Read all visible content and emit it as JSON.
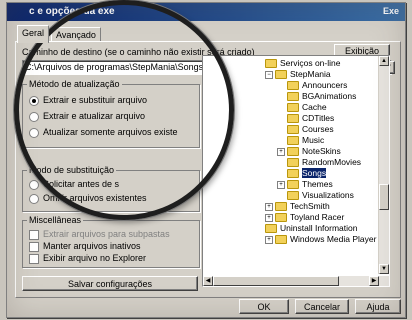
{
  "window": {
    "title": "c e opções da exe",
    "title_right": "Exe"
  },
  "tabs": [
    {
      "label": "Geral",
      "active": true
    },
    {
      "label": "Avançado",
      "active": false
    }
  ],
  "destination": {
    "label": "Caminho de destino (se o caminho não existir será criado)",
    "value": "C:\\Arquivos de programas\\StepMania\\Songs",
    "browse_label": "Exibição"
  },
  "update_method": {
    "title": "Método de atualização",
    "options": [
      {
        "label": "Extrair e substituir arquivo",
        "selected": true
      },
      {
        "label": "Extrair e atualizar arquivo",
        "selected": false
      },
      {
        "label": "Atualizar somente arquivos existe",
        "selected": false
      }
    ]
  },
  "replace_mode": {
    "title": "Modo de substituição",
    "options": [
      {
        "label": "Solicitar antes de s",
        "selected": false
      },
      {
        "label": "Omitir arquivos existentes",
        "selected": false
      }
    ]
  },
  "misc": {
    "title": "Miscellâneas",
    "checks": [
      {
        "label": "Extrair arquivos para subpastas",
        "checked": false,
        "disabled": true
      },
      {
        "label": "Manter arquivos inativos",
        "checked": false,
        "disabled": false
      },
      {
        "label": "Exibir arquivo no Explorer",
        "checked": false,
        "disabled": false
      }
    ]
  },
  "save_config_label": "Salvar configurações",
  "folder_tree": [
    {
      "label": "Serviços on-line",
      "level": 0,
      "expander": "",
      "selected": false
    },
    {
      "label": "StepMania",
      "level": 0,
      "expander": "-",
      "selected": false
    },
    {
      "label": "Announcers",
      "level": 1,
      "expander": "",
      "selected": false
    },
    {
      "label": "BGAnimations",
      "level": 1,
      "expander": "",
      "selected": false
    },
    {
      "label": "Cache",
      "level": 1,
      "expander": "",
      "selected": false
    },
    {
      "label": "CDTitles",
      "level": 1,
      "expander": "",
      "selected": false
    },
    {
      "label": "Courses",
      "level": 1,
      "expander": "",
      "selected": false
    },
    {
      "label": "Music",
      "level": 1,
      "expander": "",
      "selected": false
    },
    {
      "label": "NoteSkins",
      "level": 1,
      "expander": "+",
      "selected": false
    },
    {
      "label": "RandomMovies",
      "level": 1,
      "expander": "",
      "selected": false
    },
    {
      "label": "Songs",
      "level": 1,
      "expander": "",
      "selected": true
    },
    {
      "label": "Themes",
      "level": 1,
      "expander": "+",
      "selected": false
    },
    {
      "label": "Visualizations",
      "level": 1,
      "expander": "",
      "selected": false
    },
    {
      "label": "TechSmith",
      "level": 0,
      "expander": "+",
      "selected": false
    },
    {
      "label": "Toyland Racer",
      "level": 0,
      "expander": "+",
      "selected": false
    },
    {
      "label": "Uninstall Information",
      "level": 0,
      "expander": "",
      "selected": false
    },
    {
      "label": "Windows Media Player",
      "level": 0,
      "expander": "+",
      "selected": false
    }
  ],
  "footer": {
    "ok_label": "OK",
    "cancel_label": "Cancelar",
    "help_label": "Ajuda"
  }
}
